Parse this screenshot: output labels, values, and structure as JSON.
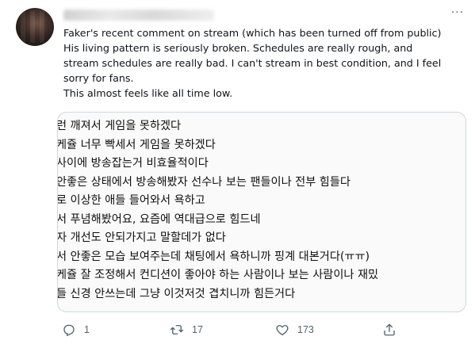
{
  "tweet": {
    "more_label": "···",
    "text_lines": [
      "Faker's recent comment on stream (which has been turned off from public)",
      "His living pattern is seriously broken. Schedules are really rough, and",
      "stream schedules are really bad. I can't stream in best condition, and I feel",
      "sorry for fans.",
      "This almost feels like all time low."
    ]
  },
  "media": {
    "lines": [
      "런 깨져서 게임을 못하겠다",
      "케쥴 너무 빡세서 게임을 못하겠다",
      "사이에 방송잡는거 비효율적이다",
      "안좋은 상태에서 방송해봤자 선수나 보는 팬들이나 전부 힘들다",
      "로 이상한 애들 들어와서 욕하고",
      "서 푸념해봤어요, 요즘에 역대급으로 힘드네",
      "자 개선도 안되가지고 말할데가 없다",
      "서 안좋은 모습 보여주는데 채팅에서 욕하니까 핑계 대본거다(ㅠㅠ)",
      "케쥴 잘 조정해서 컨디션이 좋아야 하는 사람이나 보는 사람이나 재밌",
      "들 신경 안쓰는데 그냥 이것저것 겹치니까 힘든거다"
    ]
  },
  "actions": {
    "reply": {
      "icon": "reply-icon",
      "count": "1"
    },
    "retweet": {
      "icon": "retweet-icon",
      "count": "17"
    },
    "like": {
      "icon": "heart-icon",
      "count": "173"
    },
    "share": {
      "icon": "share-icon"
    }
  },
  "colors": {
    "secondary": "#536471",
    "border": "#cfd9de",
    "text": "#0f1419"
  }
}
